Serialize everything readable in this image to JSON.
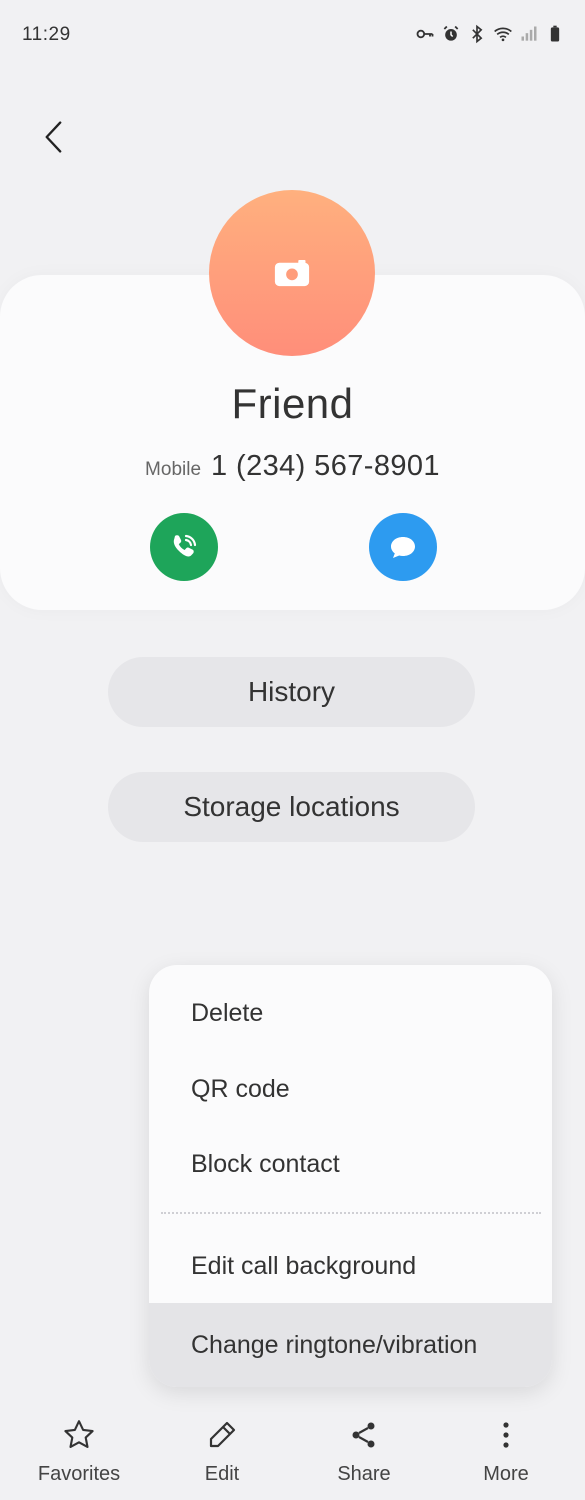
{
  "status_bar": {
    "time": "11:29",
    "icons": [
      "key-icon",
      "alarm-icon",
      "bluetooth-icon",
      "wifi-icon",
      "signal-icon",
      "battery-icon"
    ]
  },
  "header": {
    "back_icon": "back-chevron-icon"
  },
  "contact": {
    "name": "Friend",
    "phone_label": "Mobile",
    "phone_number": "1 (234) 567-8901",
    "avatar_icon": "camera-icon",
    "avatar_color": "#ff9d7c"
  },
  "actions": {
    "call_icon": "wifi-call-icon",
    "call_color": "#1ea55a",
    "message_icon": "message-icon",
    "message_color": "#2d9bf0"
  },
  "pills": {
    "history": "History",
    "storage": "Storage locations"
  },
  "menu": {
    "items": [
      {
        "label": "Delete"
      },
      {
        "label": "QR code"
      },
      {
        "label": "Block contact"
      },
      {
        "label": "Edit call background"
      },
      {
        "label": "Change ringtone/vibration",
        "highlighted": true
      }
    ]
  },
  "bottom_nav": {
    "items": [
      {
        "label": "Favorites",
        "icon": "star-icon"
      },
      {
        "label": "Edit",
        "icon": "pencil-icon"
      },
      {
        "label": "Share",
        "icon": "share-icon"
      },
      {
        "label": "More",
        "icon": "more-vertical-icon"
      }
    ]
  }
}
